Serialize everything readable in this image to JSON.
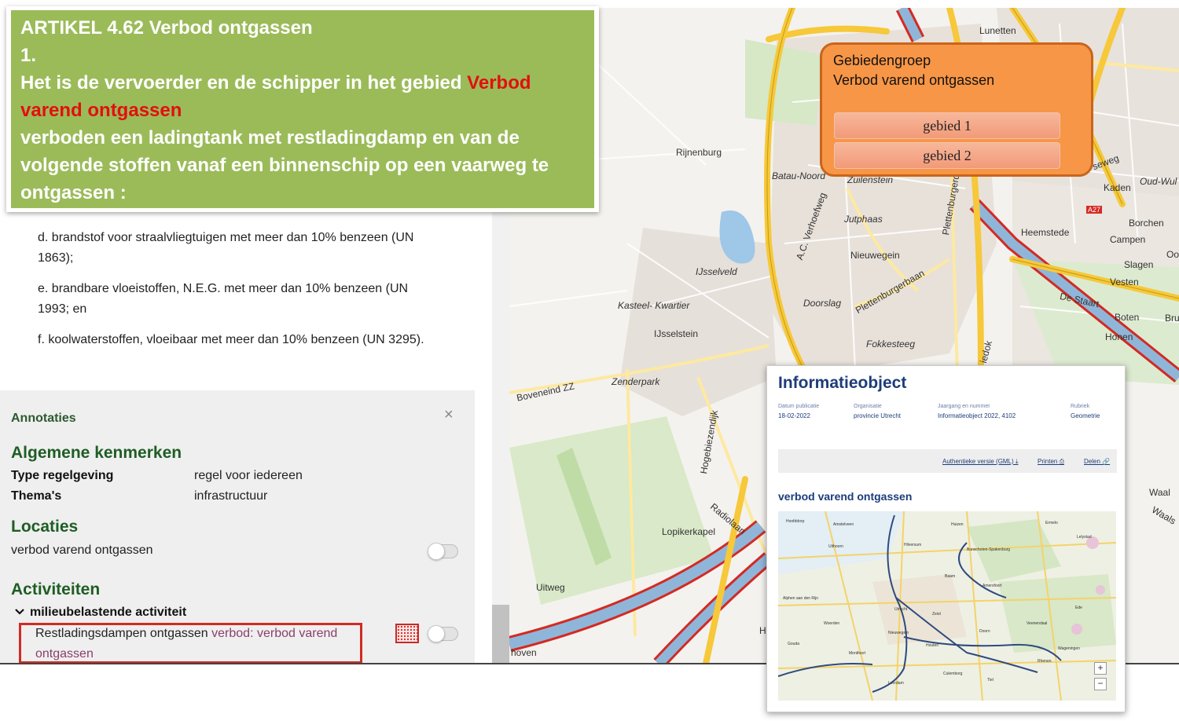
{
  "article": {
    "heading": "ARTIKEL 4.62 Verbod ontgassen",
    "number": "1.",
    "text_before": "Het is de vervoerder en de schipper in het gebied ",
    "text_red": "Verbod varend ontgassen",
    "text_after": "verboden een ladingtank met restladingdamp en van de volgende stoffen vanaf een binnenschip op een vaarweg te ontgassen :"
  },
  "doc_items": [
    "d. brandstof voor straalvliegtuigen met meer dan 10% benzeen (UN 1863);",
    "e. brandbare vloeistoffen, N.E.G. met meer dan 10% benzeen (UN 1993; en",
    "f. koolwaterstoffen, vloeibaar met meer dan 10% benzeen (UN 3295)."
  ],
  "annotations": {
    "title": "Annotaties",
    "close": "×",
    "general_heading": "Algemene kenmerken",
    "type_label": "Type regelgeving",
    "type_value": "regel voor iedereen",
    "themes_label": "Thema's",
    "themes_value": "infrastructuur",
    "locations_heading": "Locaties",
    "location_item": "verbod varend ontgassen",
    "activities_heading": "Activiteiten",
    "activity_group": "milieubelastende activiteit",
    "activity_text": "Restladingsdampen ontgassen ",
    "activity_link": "verbod: verbod varend ontgassen"
  },
  "group": {
    "title_line1": "Gebiedengroep",
    "title_line2": "Verbod varend ontgassen",
    "area1": "gebied 1",
    "area2": "gebied 2"
  },
  "map_labels": {
    "lunetten": "Lunetten",
    "rijnenburg": "Rijnenburg",
    "batau": "Batau-Noord",
    "zuilenstein": "Zuilenstein",
    "jutphaas": "Jutphaas",
    "nieuwegein": "Nieuwegein",
    "ijsselveld": "IJsselveld",
    "verhoefweg": "A.C. Verhoefweg",
    "plettenburgerbaan": "Plettenburgerbaan",
    "plettenburgerdijk": "Plettenburgerdijk",
    "kasteel": "Kasteel- Kwartier",
    "doorslag": "Doorslag",
    "ijsselstein": "IJsselstein",
    "fokkesteeg": "Fokkesteeg",
    "boveneind": "Boveneind ZZ",
    "zenderpark": "Zenderpark",
    "hogebiezendijk": "Hogebiezendijk",
    "radiolaan": "Radiolaan",
    "lopikerkapel": "Lopikerkapel",
    "uitweg": "Uitweg",
    "hoven": "hoven",
    "heemstede": "Heemstede",
    "kaden": "Kaden",
    "oudwul": "Oud-Wul",
    "borchen": "Borchen",
    "campen": "Campen",
    "slagen": "Slagen",
    "vesten": "Vesten",
    "destaart": "De Staart",
    "boten": "Boten",
    "honen": "Honen",
    "waal": "Waal",
    "a27": "A27",
    "seweg": "seweg",
    "oo": "Oo",
    "bru": "Bru",
    "waals": "Waals",
    "iedok": "iedok",
    "h": "H"
  },
  "info_object": {
    "title": "Informatieobject",
    "meta_date_label": "Datum publicatie",
    "meta_date_value": "18-02-2022",
    "meta_org_label": "Organisatie",
    "meta_org_value": "provincie Utrecht",
    "meta_year_label": "Jaargang en nummer",
    "meta_year_value": "Informatieobject 2022, 4102",
    "meta_rubric_label": "Rubriek",
    "meta_rubric_value": "Geometrie",
    "action_auth": "Authentieke versie (GML) ⤓",
    "action_print": "Printen ⎙",
    "action_share": "Delen 🔗",
    "subtitle": "verbod varend ontgassen",
    "zoom_in": "+",
    "zoom_out": "−",
    "minimap_labels": {
      "hoofddorp": "Hoofddorp",
      "amstelveen": "Amstelveen",
      "uithoorn": "Uithoorn",
      "hilversum": "Hilversum",
      "huizen": "Huizen",
      "ermelo": "Ermelo",
      "bunschoten": "Bunschoten-Spakenburg",
      "baarn": "Baarn",
      "amersfoort": "Amersfoort",
      "utrecht": "Utrecht",
      "zeist": "Zeist",
      "nieuwegein": "Nieuwegein",
      "veenendaal": "Veenendaal",
      "wageningen": "Wageningen",
      "alphen": "Alphen aan den Rijn",
      "woerden": "Woerden",
      "gouda": "Gouda",
      "leerdam": "Leerdam",
      "tiel": "Tiel",
      "culemborg": "Culemborg",
      "ede": "Ede",
      "doorn": "Doorn",
      "rhenen": "Rhenen",
      "lelystad": "Lelystad",
      "houten": "Houten",
      "montfoort": "Montfoort"
    }
  },
  "colors": {
    "article_bg": "#9bbb59",
    "article_red": "#e20f0f",
    "callout_bg": "#f79646",
    "highlight_red": "#d32a23",
    "motorway": "#f6c83a",
    "water": "#9ec7e8",
    "heading_green": "#1f5d25",
    "info_blue": "#1d3c7a"
  },
  "icons": {
    "close": "close-icon",
    "chevron": "chevron-down-icon",
    "swatch": "hatched-area-icon"
  }
}
